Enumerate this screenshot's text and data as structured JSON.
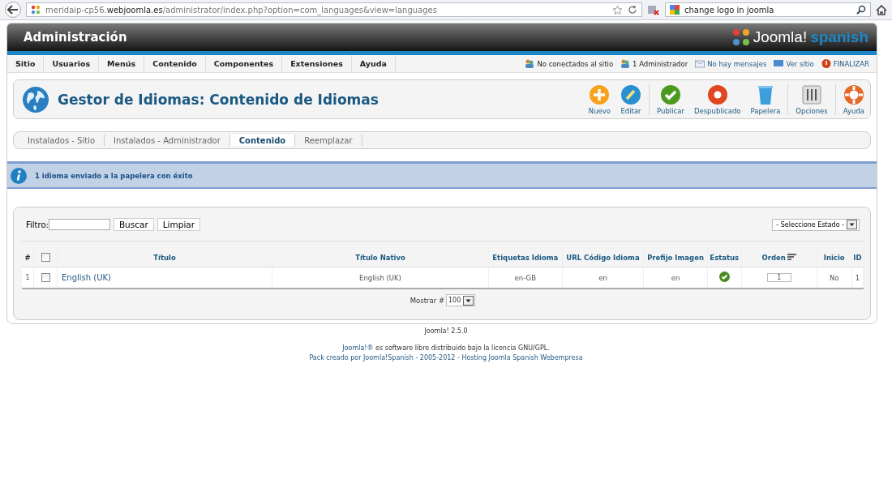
{
  "browser": {
    "url": "meridaip-cp56.**webjoomla.es**/administrator/index.php?option=com_languages&view=languages",
    "search_value": "change logo in joomla"
  },
  "header": {
    "title": "Administración",
    "logo_word": "Joomla!",
    "logo_tag": "spanish"
  },
  "menu": [
    "Sitio",
    "Usuarios",
    "Menús",
    "Contenido",
    "Componentes",
    "Extensiones",
    "Ayuda"
  ],
  "status": [
    {
      "kind": "visitors",
      "label": "No conectados al sitio",
      "link": false
    },
    {
      "kind": "admins",
      "label": "1 Administrador",
      "link": false
    },
    {
      "kind": "messages",
      "label": "No hay mensajes",
      "link": true
    },
    {
      "kind": "site",
      "label": "Ver sitio",
      "link": true
    },
    {
      "kind": "logout",
      "label": "FINALIZAR",
      "link": true
    }
  ],
  "page_title": "Gestor de Idiomas: Contenido de Idiomas",
  "toolbar": [
    {
      "kind": "new",
      "label": "Nuevo",
      "separator_before": false
    },
    {
      "kind": "edit",
      "label": "Editar",
      "separator_before": false
    },
    {
      "kind": "publish",
      "label": "Publicar",
      "separator_before": true
    },
    {
      "kind": "unpublish",
      "label": "Despublicado",
      "separator_before": false
    },
    {
      "kind": "trash",
      "label": "Papelera",
      "separator_before": false
    },
    {
      "kind": "options",
      "label": "Opciones",
      "separator_before": true
    },
    {
      "kind": "help",
      "label": "Ayuda",
      "separator_before": true
    }
  ],
  "submenu": [
    {
      "label": "Instalados - Sitio",
      "selected": false
    },
    {
      "label": "Instalados - Administrador",
      "selected": false
    },
    {
      "label": "Contenido",
      "selected": true
    },
    {
      "label": "Reemplazar",
      "selected": false
    }
  ],
  "message": "1 idioma enviado a la papelera con éxito",
  "filter": {
    "label": "Filtro:",
    "search_button": "Buscar",
    "clear_button": "Limpiar",
    "state_select": "- Seleccione Estado -"
  },
  "table": {
    "select_all_checked": false,
    "columns": [
      "#",
      "Título",
      "Título Nativo",
      "Etiquetas Idioma",
      "URL Código Idioma",
      "Prefijo Imagen",
      "Estatus",
      "Orden",
      "Inicio",
      "ID"
    ],
    "rows": [
      {
        "num": "1",
        "checked": false,
        "title": "English (UK)",
        "native": "English (UK)",
        "tag": "en-GB",
        "url_code": "en",
        "prefix": "en",
        "published": true,
        "order": "1",
        "home": "No",
        "id": "1"
      }
    ]
  },
  "pagination": {
    "label": "Mostrar #",
    "value": "100"
  },
  "footer": {
    "version": "Joomla! 2.5.0",
    "license_link": "Joomla!®",
    "license_text": "es software libre distribuido bajo la licencia GNU/GPL.",
    "credits": "Pack creado por Joomla!Spanish - 2005-2012 - Hosting Joomla Spanish Webempresa"
  }
}
